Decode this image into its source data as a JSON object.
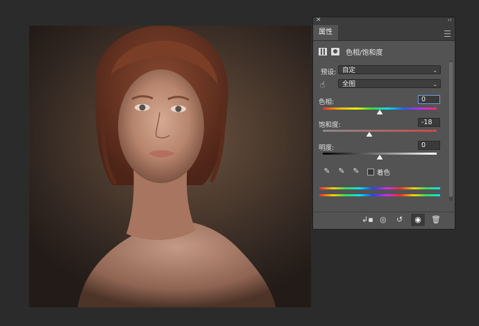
{
  "panel": {
    "tab_label": "属性",
    "adjustment_title": "色相/饱和度",
    "preset_label": "预设:",
    "preset_value": "自定",
    "channel_value": "全图",
    "hue_label": "色相:",
    "hue_value": "0",
    "saturation_label": "饱和度:",
    "saturation_value": "-18",
    "lightness_label": "明度:",
    "lightness_value": "0",
    "colorize_label": "着色",
    "colorize_checked": false,
    "hue_slider_fraction": 0.5,
    "saturation_slider_fraction": 0.41,
    "lightness_slider_fraction": 0.5
  },
  "icons": {
    "close": "close-icon",
    "collapse": "collapse-icon",
    "menu": "panel-menu-icon",
    "adjustment": "adjustment-layer-icon",
    "mask": "mask-icon",
    "hand": "targeted-adjustment-hand-icon",
    "eyedropper": "eyedropper-icon",
    "eyedropper_add": "eyedropper-plus-icon",
    "eyedropper_sub": "eyedropper-minus-icon",
    "clip": "clip-to-layer-icon",
    "view_previous": "view-previous-icon",
    "reset": "reset-icon",
    "visibility": "eye-icon",
    "delete": "trash-icon"
  },
  "colors": {
    "panel_bg": "#535353",
    "app_bg": "#2b2b2b",
    "accent_focus": "#6f9ee0"
  }
}
